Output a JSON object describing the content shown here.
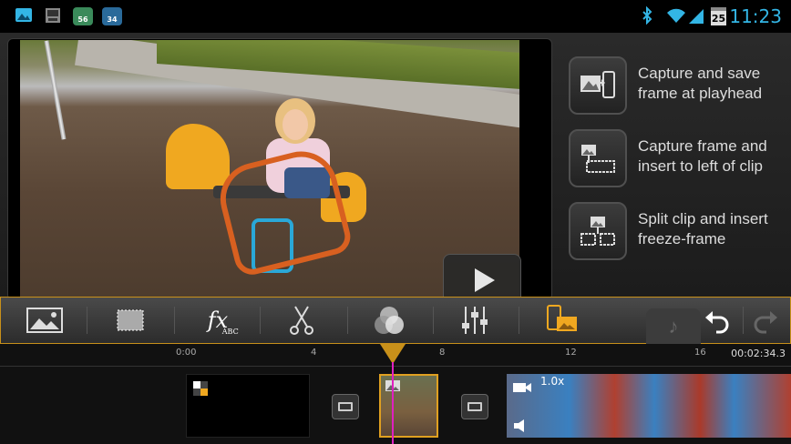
{
  "status_bar": {
    "notif_badge_1": "56",
    "notif_badge_2": "34",
    "calendar_day": "25",
    "clock": "11:23"
  },
  "preview": {
    "play_label": "Play"
  },
  "actions": [
    {
      "label": "Capture and save frame at playhead"
    },
    {
      "label": "Capture frame and insert to left of clip"
    },
    {
      "label": "Split clip and insert freeze-frame"
    }
  ],
  "toolbar": {
    "fx_label": "fx",
    "fx_sub": "ABC"
  },
  "timeline": {
    "ticks": [
      "0:00",
      "4",
      "8",
      "12",
      "16"
    ],
    "duration": "00:02:34.3",
    "speed": "1.0x"
  },
  "colors": {
    "accent": "#c8901a",
    "clock": "#33b5e5",
    "playhead": "#e020c0"
  }
}
